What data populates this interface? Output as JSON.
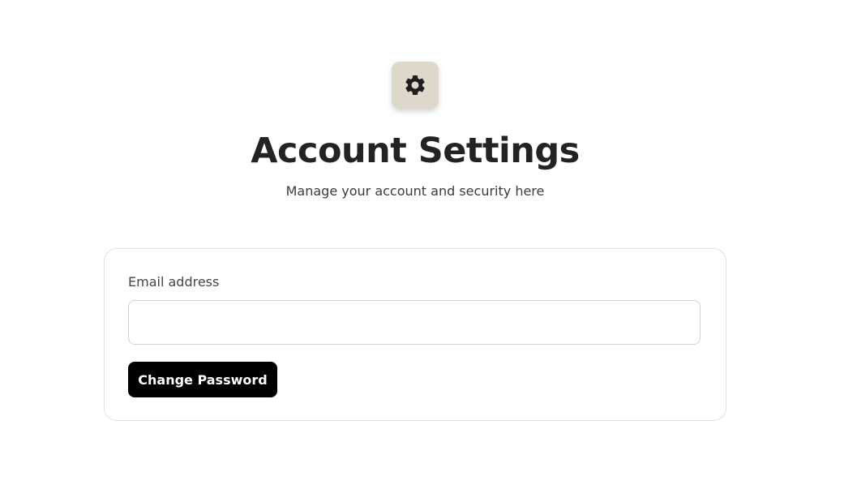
{
  "header": {
    "icon": "gear-icon",
    "title": "Account Settings",
    "subtitle": "Manage your account and security here"
  },
  "form": {
    "email_label": "Email address",
    "email_value": "",
    "email_placeholder": "",
    "change_password_label": "Change Password"
  },
  "colors": {
    "icon_tile_bg": "#ded8ca",
    "button_bg": "#000000",
    "button_text": "#ffffff",
    "title_text": "#232323"
  }
}
